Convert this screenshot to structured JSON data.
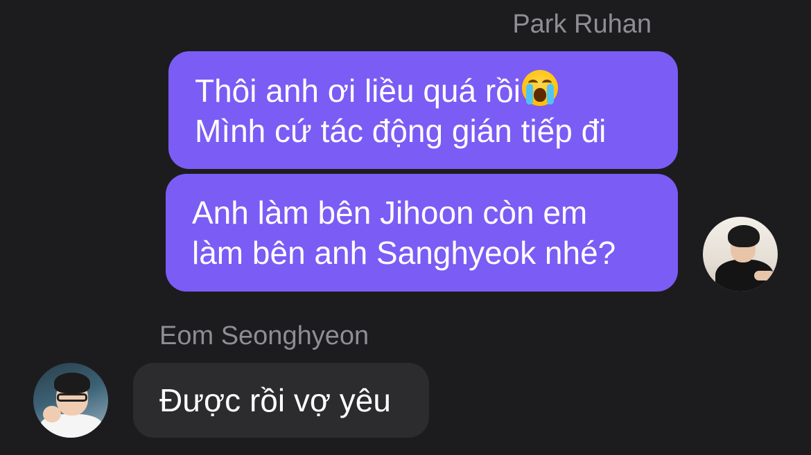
{
  "conversation": {
    "messages": [
      {
        "sender": "Park Ruhan",
        "direction": "outgoing",
        "lines": [
          "Thôi anh ơi liều quá rồi",
          "Mình cứ tác động gián tiếp đi"
        ],
        "emoji": "loudly-crying-face"
      },
      {
        "sender": "Park Ruhan",
        "direction": "outgoing",
        "lines": [
          "Anh làm bên Jihoon còn em",
          "làm bên anh Sanghyeok nhé?"
        ]
      },
      {
        "sender": "Eom Seonghyeon",
        "direction": "incoming",
        "lines": [
          "Được rồi vợ yêu"
        ]
      }
    ]
  },
  "colors": {
    "background": "#1c1c1e",
    "outgoing_bubble": "#7b5cf5",
    "incoming_bubble": "#2c2c2e",
    "sender_name": "#8e8e93",
    "text": "#ffffff"
  }
}
